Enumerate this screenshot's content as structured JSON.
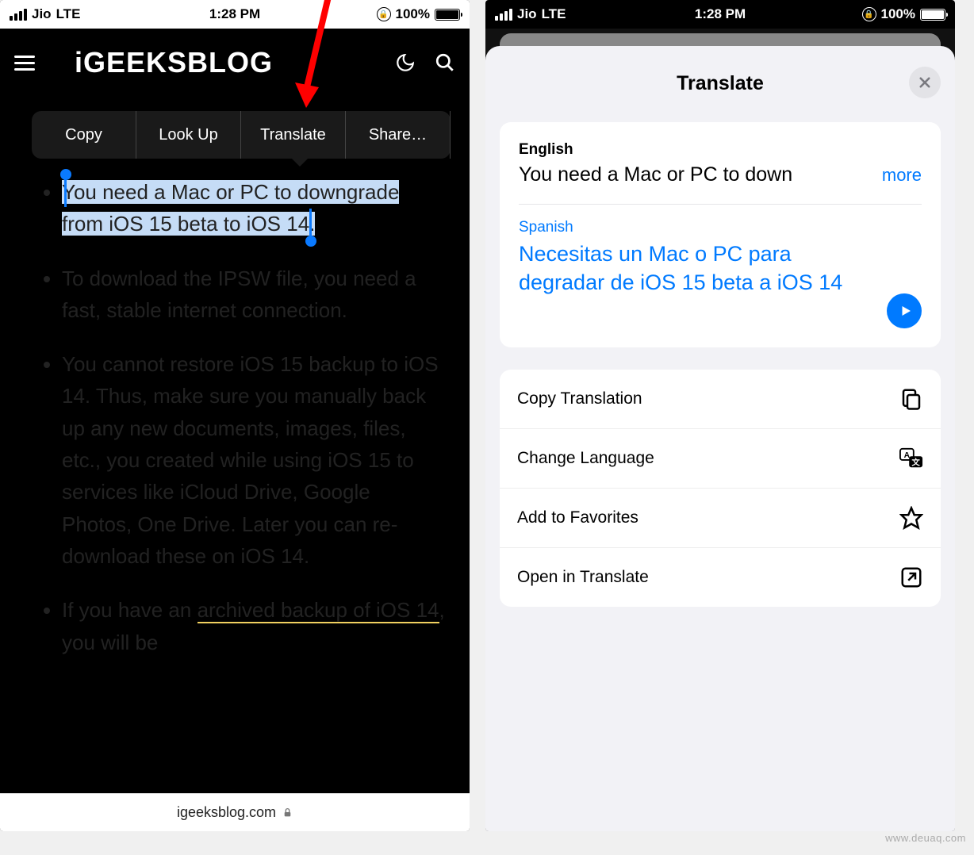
{
  "status": {
    "carrier": "Jio",
    "network": "LTE",
    "time": "1:28 PM",
    "battery_pct": "100%"
  },
  "left": {
    "logo_text": "iGEEKSBLOG",
    "selection_menu": [
      "Copy",
      "Look Up",
      "Translate",
      "Share…"
    ],
    "bullets": [
      "You need a Mac or PC to downgrade from iOS 15 beta to iOS 14.",
      "To download the IPSW file, you need a fast, stable internet connection.",
      "You cannot restore iOS 15 backup to iOS 14. Thus, make sure you manually back up any new documents, images, files, etc., you created while using iOS 15 to services like iCloud Drive, Google Photos, One Drive. Later you can re-download these on iOS 14.",
      "If you have an "
    ],
    "bullet4_link": "archived backup of iOS 14",
    "bullet4_tail": ", you will be",
    "domain": "igeeksblog.com"
  },
  "right": {
    "sheet_title": "Translate",
    "source_lang": "English",
    "source_text": "You need a Mac or PC to down",
    "more_label": "more",
    "target_lang": "Spanish",
    "target_text": "Necesitas un Mac o PC para degradar de iOS 15 beta a iOS 14",
    "actions": [
      "Copy Translation",
      "Change Language",
      "Add to Favorites",
      "Open in Translate"
    ]
  },
  "watermark": "www.deuaq.com"
}
